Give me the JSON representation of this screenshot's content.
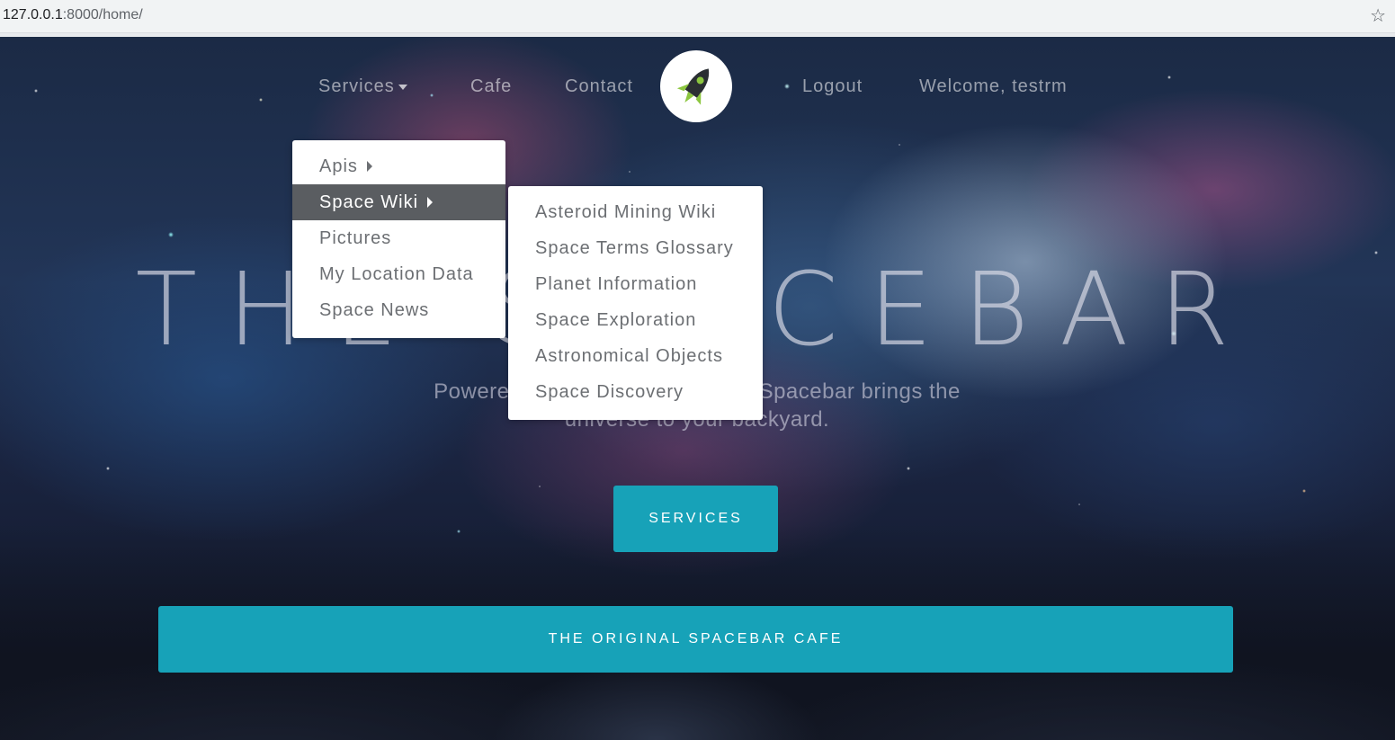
{
  "browser": {
    "url_host": "127.0.0.1",
    "url_path": ":8000/home/",
    "bookmark_icon": "star-icon"
  },
  "nav": {
    "services_label": "Services",
    "cafe_label": "Cafe",
    "contact_label": "Contact",
    "logout_label": "Logout",
    "welcome_text": "Welcome, testrm",
    "logo_icon": "rocket-icon"
  },
  "hero": {
    "title": "THE SPACEBAR",
    "subtitle": "Powered by the Space API, The Spacebar brings the universe to your backyard."
  },
  "services_menu": {
    "items": [
      {
        "label": "Apis",
        "has_submenu": true
      },
      {
        "label": "Space Wiki",
        "has_submenu": true,
        "active": true
      },
      {
        "label": "Pictures"
      },
      {
        "label": "My Location Data"
      },
      {
        "label": "Space News"
      }
    ]
  },
  "space_wiki_menu": {
    "items": [
      {
        "label": "Asteroid Mining Wiki"
      },
      {
        "label": "Space Terms Glossary"
      },
      {
        "label": "Planet Information"
      },
      {
        "label": "Space Exploration"
      },
      {
        "label": "Astronomical Objects"
      },
      {
        "label": "Space Discovery"
      }
    ]
  },
  "buttons": {
    "services_label": "SERVICES",
    "cafe_label": "THE ORIGINAL SPACEBAR CAFE"
  },
  "colors": {
    "accent": "#17a2b8",
    "menu_active_bg": "#5a5d61",
    "menu_text": "#6c6f73"
  }
}
